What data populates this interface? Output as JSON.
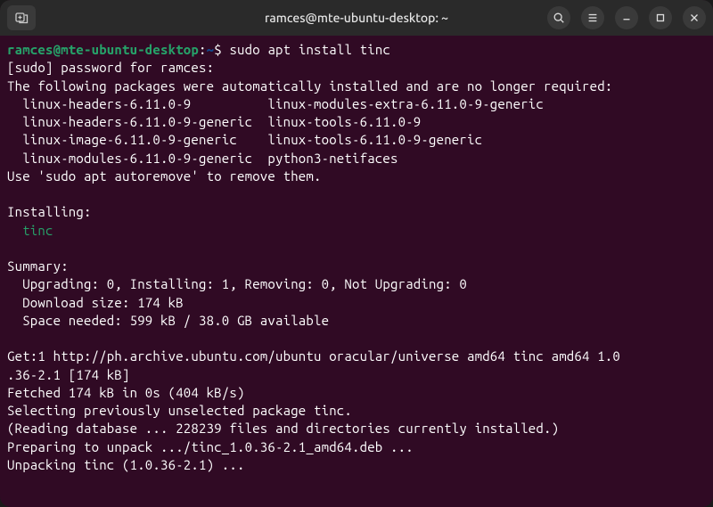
{
  "titlebar": {
    "title": "ramces@mte-ubuntu-desktop: ~"
  },
  "prompt": {
    "user_host": "ramces@mte-ubuntu-desktop",
    "separator": ":",
    "path": "~",
    "symbol": "$"
  },
  "command": "sudo apt install tinc",
  "output": {
    "sudo_prompt": "[sudo] password for ramces:",
    "auto_remove_header": "The following packages were automatically installed and are no longer required:",
    "pkg_line1": "  linux-headers-6.11.0-9          linux-modules-extra-6.11.0-9-generic",
    "pkg_line2": "  linux-headers-6.11.0-9-generic  linux-tools-6.11.0-9",
    "pkg_line3": "  linux-image-6.11.0-9-generic    linux-tools-6.11.0-9-generic",
    "pkg_line4": "  linux-modules-6.11.0-9-generic  python3-netifaces",
    "auto_remove_hint": "Use 'sudo apt autoremove' to remove them.",
    "installing_header": "Installing:",
    "installing_pkg": "  tinc",
    "summary_header": "Summary:",
    "summary_line1": "  Upgrading: 0, Installing: 1, Removing: 0, Not Upgrading: 0",
    "summary_line2": "  Download size: 174 kB",
    "summary_line3": "  Space needed: 599 kB / 38.0 GB available",
    "get_line1": "Get:1 http://ph.archive.ubuntu.com/ubuntu oracular/universe amd64 tinc amd64 1.0",
    "get_line2": ".36-2.1 [174 kB]",
    "fetched": "Fetched 174 kB in 0s (404 kB/s)",
    "selecting": "Selecting previously unselected package tinc.",
    "reading_db": "(Reading database ... 228239 files and directories currently installed.)",
    "preparing": "Preparing to unpack .../tinc_1.0.36-2.1_amd64.deb ...",
    "unpacking": "Unpacking tinc (1.0.36-2.1) ..."
  }
}
